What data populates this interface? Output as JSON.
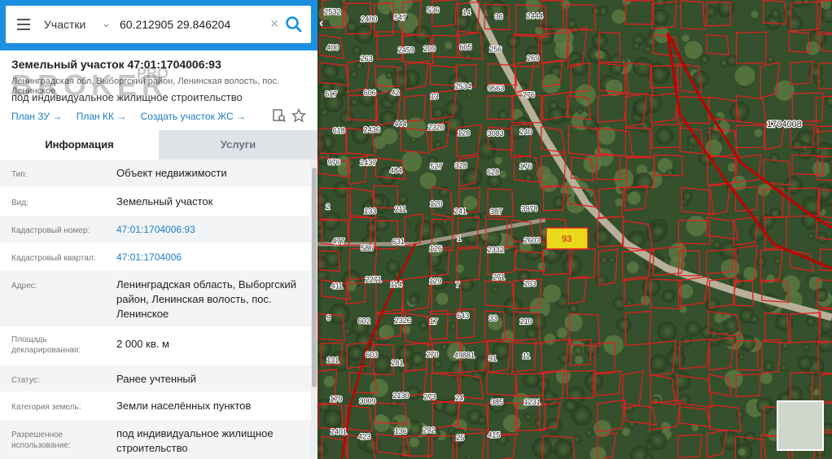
{
  "search": {
    "scope": "Участки",
    "query": "60.212905 29.846204"
  },
  "parcel": {
    "title": "Земельный участок 47:01:1704006:93",
    "address_short": "Ленинградская обл, Выборгский район, Ленинская волость, пос. Ленинское",
    "use": "под индивидуальное жилищное строительство"
  },
  "watermark": {
    "main": "BROKER",
    "sup": "PRO"
  },
  "links": {
    "plan_zu": "План ЗУ",
    "plan_kk": "План КК",
    "create": "Создать участок ЖС"
  },
  "tabs": {
    "info": "Информация",
    "services": "Услуги"
  },
  "info": [
    {
      "label": "Тип:",
      "value": "Объект недвижимости"
    },
    {
      "label": "Вид:",
      "value": "Земельный участок"
    },
    {
      "label": "Кадастровый номер:",
      "value": "47:01:1704006:93"
    },
    {
      "label": "Кадастровый квартал:",
      "value": "47:01:1704006"
    },
    {
      "label": "Адрес:",
      "value": "Ленинградская область, Выборгский район, Ленинская волость, пос. Ленинское"
    },
    {
      "label": "Площадь декларированная:",
      "value": "2 000 кв. м"
    },
    {
      "label": "Статус:",
      "value": "Ранее учтенный"
    },
    {
      "label": "Категория земель:",
      "value": "Земли населённых пунктов"
    },
    {
      "label": "Разрешенное использование:",
      "value": "под индивидуальное жилищное строительство"
    }
  ],
  "map": {
    "highlight_label": "93",
    "quarter_labels": [
      "1704008"
    ],
    "parcel_labels": [
      "2532",
      "400",
      "617",
      "618",
      "976",
      "2",
      "477",
      "411",
      "9",
      "131",
      "179",
      "2401",
      "2400",
      "263",
      "606",
      "2436",
      "2437",
      "133",
      "586",
      "2271",
      "602",
      "603",
      "3009",
      "423",
      "547",
      "2459",
      "42",
      "444",
      "484",
      "211",
      "631",
      "114",
      "2326",
      "281",
      "2130",
      "136",
      "536",
      "209",
      "13",
      "2320",
      "527",
      "120",
      "126",
      "129",
      "17",
      "270",
      "273",
      "292",
      "14",
      "605",
      "2534",
      "128",
      "328",
      "241",
      "1",
      "7",
      "643",
      "49881",
      "24",
      "25",
      "36",
      "256",
      "9563",
      "3083",
      "628",
      "387",
      "2332",
      "271",
      "33",
      "91",
      "385",
      "415",
      "2444",
      "269",
      "276",
      "240",
      "176",
      "3978",
      "2603",
      "203",
      "210",
      "11",
      "1231"
    ],
    "colors": {
      "boundary": "#e02020",
      "quarter": "#c00000",
      "highlight": "#f3e11c"
    }
  }
}
